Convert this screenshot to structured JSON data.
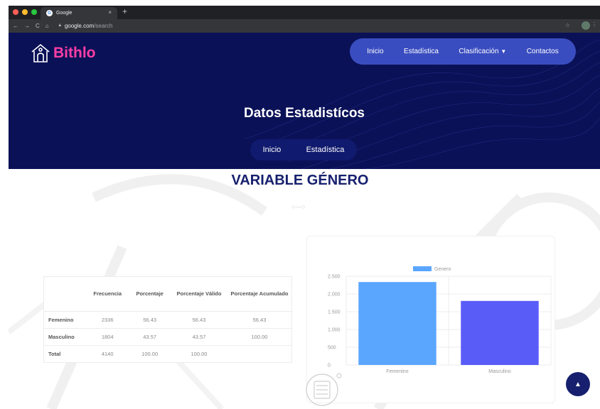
{
  "browser": {
    "tab_title": "Google",
    "tab_close": "×",
    "new_tab": "+",
    "url_host": "google.com",
    "url_path": "/search"
  },
  "site": {
    "brand": "Bithlo",
    "nav": [
      {
        "label": "Inicio"
      },
      {
        "label": "Estadística"
      },
      {
        "label": "Clasificación"
      },
      {
        "label": "Contactos"
      }
    ],
    "hero_title": "Datos Estadistícos",
    "breadcrumbs": [
      {
        "label": "Inicio"
      },
      {
        "label": "Estadística"
      }
    ]
  },
  "section": {
    "title": "VARIABLE GÉNERO"
  },
  "table": {
    "headers": [
      "",
      "Frecuencia",
      "Porcentaje",
      "Porcentaje Válido",
      "Porcentaje Acumulado"
    ],
    "rows": [
      [
        "Femenino",
        "2336",
        "56.43",
        "56.43",
        "56.43"
      ],
      [
        "Masculino",
        "1804",
        "43.57",
        "43.57",
        "100.00"
      ],
      [
        "Total",
        "4140",
        "100.00",
        "100.00",
        ""
      ]
    ]
  },
  "chart_data": {
    "type": "bar",
    "categories": [
      "Femenino",
      "Masculino"
    ],
    "series": [
      {
        "name": "Genero",
        "values": [
          2336,
          1804
        ],
        "colors": [
          "#5aa6ff",
          "#5a5cf8"
        ]
      }
    ],
    "yticks": [
      "0",
      "500",
      "1.000",
      "1.500",
      "2.000",
      "2.500"
    ],
    "ylim": [
      0,
      2500
    ],
    "legend": "top",
    "grid": true
  },
  "colors": {
    "header_bg": "#0a1157",
    "nav_bg": "#3a4dc0",
    "brand_pink": "#ff3ea5",
    "title_navy": "#17206e"
  },
  "icons": {
    "logo": "building-logo-icon",
    "dropdown": "chevron-down-icon",
    "scroll_top": "chevron-up-icon"
  }
}
